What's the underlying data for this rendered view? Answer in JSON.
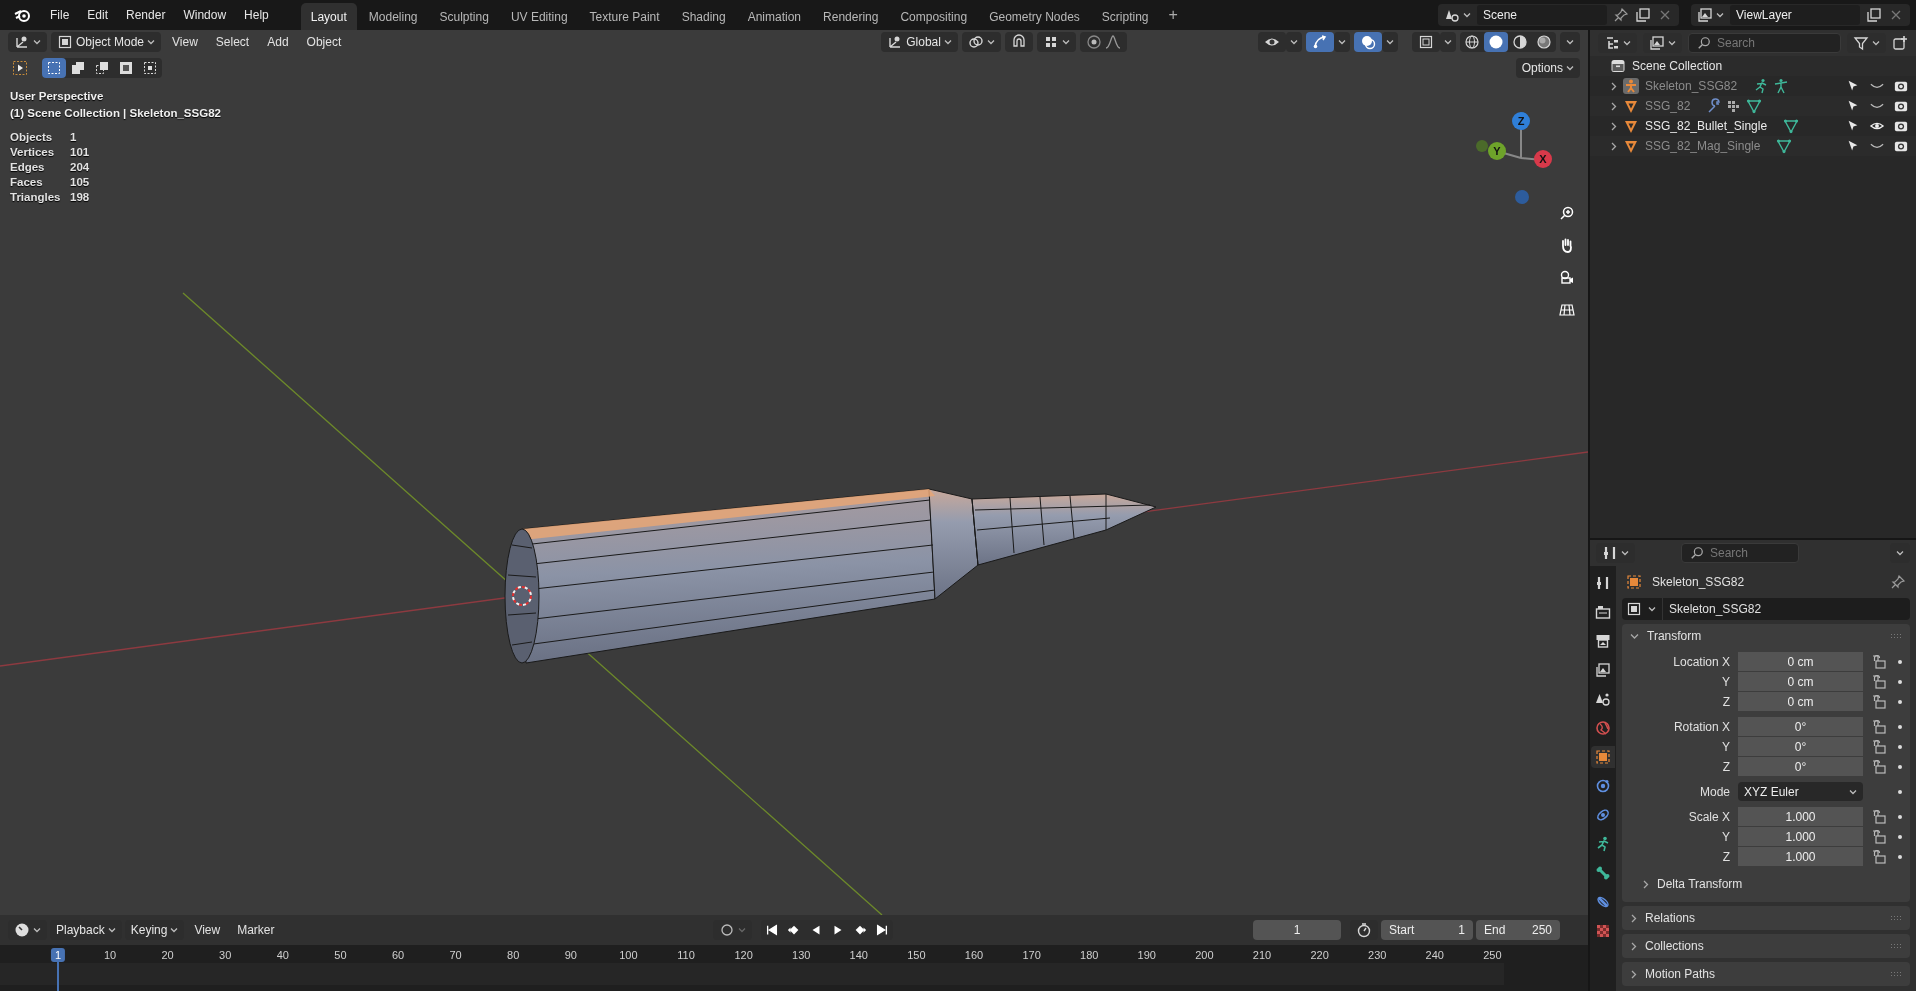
{
  "topbar": {
    "menus": [
      "File",
      "Edit",
      "Render",
      "Window",
      "Help"
    ],
    "workspaces": [
      {
        "label": "Layout",
        "selected": true
      },
      {
        "label": "Modeling",
        "selected": false
      },
      {
        "label": "Sculpting",
        "selected": false
      },
      {
        "label": "UV Editing",
        "selected": false
      },
      {
        "label": "Texture Paint",
        "selected": false
      },
      {
        "label": "Shading",
        "selected": false
      },
      {
        "label": "Animation",
        "selected": false
      },
      {
        "label": "Rendering",
        "selected": false
      },
      {
        "label": "Compositing",
        "selected": false
      },
      {
        "label": "Geometry Nodes",
        "selected": false
      },
      {
        "label": "Scripting",
        "selected": false
      }
    ],
    "add_workspace": "+",
    "scene": "Scene",
    "view_layer": "ViewLayer"
  },
  "viewport": {
    "mode": "Object Mode",
    "menus": [
      "View",
      "Select",
      "Add",
      "Object"
    ],
    "orientation": "Global",
    "toggles": [
      {
        "kind": "visibility",
        "on": false
      },
      {
        "kind": "gizmo",
        "on": true
      },
      {
        "kind": "overlay",
        "on": true
      },
      {
        "kind": "xray",
        "on": false
      }
    ],
    "shading": [
      {
        "kind": "wireframe",
        "selected": false
      },
      {
        "kind": "solid",
        "selected": true
      },
      {
        "kind": "material",
        "selected": false
      },
      {
        "kind": "rendered",
        "selected": false
      }
    ],
    "select_modes": [
      {
        "kind": "set",
        "selected": true
      },
      {
        "kind": "extend",
        "selected": false
      },
      {
        "kind": "subtract",
        "selected": false
      },
      {
        "kind": "invert",
        "selected": false
      },
      {
        "kind": "intersect",
        "selected": false
      }
    ],
    "options": "Options",
    "view_name": "User Perspective",
    "context": "(1) Scene Collection | Skeleton_SSG82",
    "stats": [
      {
        "label": "Objects",
        "value": "1"
      },
      {
        "label": "Vertices",
        "value": "101"
      },
      {
        "label": "Edges",
        "value": "204"
      },
      {
        "label": "Faces",
        "value": "105"
      },
      {
        "label": "Triangles",
        "value": "198"
      }
    ],
    "gizmo_axes": [
      {
        "label": "Z",
        "color": "#2f7fd8"
      },
      {
        "label": "Y",
        "color": "#6ea32a"
      },
      {
        "label": "X",
        "color": "#d8394a"
      }
    ]
  },
  "timeline": {
    "menus": [
      {
        "label": "Playback",
        "dropdown": true
      },
      {
        "label": "Keying",
        "dropdown": true
      },
      {
        "label": "View",
        "dropdown": false
      },
      {
        "label": "Marker",
        "dropdown": false
      }
    ],
    "current_frame": "1",
    "start_label": "Start",
    "start": "1",
    "end_label": "End",
    "end": "250",
    "ruler": [
      {
        "label": "1",
        "selected": true
      },
      {
        "label": "10",
        "selected": false
      },
      {
        "label": "20",
        "selected": false
      },
      {
        "label": "30",
        "selected": false
      },
      {
        "label": "40",
        "selected": false
      },
      {
        "label": "50",
        "selected": false
      },
      {
        "label": "60",
        "selected": false
      },
      {
        "label": "70",
        "selected": false
      },
      {
        "label": "80",
        "selected": false
      },
      {
        "label": "90",
        "selected": false
      },
      {
        "label": "100",
        "selected": false
      },
      {
        "label": "110",
        "selected": false
      },
      {
        "label": "120",
        "selected": false
      },
      {
        "label": "130",
        "selected": false
      },
      {
        "label": "140",
        "selected": false
      },
      {
        "label": "150",
        "selected": false
      },
      {
        "label": "160",
        "selected": false
      },
      {
        "label": "170",
        "selected": false
      },
      {
        "label": "180",
        "selected": false
      },
      {
        "label": "190",
        "selected": false
      },
      {
        "label": "200",
        "selected": false
      },
      {
        "label": "210",
        "selected": false
      },
      {
        "label": "220",
        "selected": false
      },
      {
        "label": "230",
        "selected": false
      },
      {
        "label": "240",
        "selected": false
      },
      {
        "label": "250",
        "selected": false
      }
    ]
  },
  "outliner": {
    "search_placeholder": "Search",
    "root": "Scene Collection",
    "items": [
      {
        "name": "Skeleton_SSG82",
        "kind": "armature",
        "visible": false,
        "badges": [
          {
            "kind": "armature"
          },
          {
            "kind": "pose"
          }
        ]
      },
      {
        "name": "SSG_82",
        "kind": "mesh",
        "visible": false,
        "badges": [
          {
            "kind": "modifier"
          },
          {
            "kind": "vertex-groups"
          },
          {
            "kind": "mesh"
          }
        ]
      },
      {
        "name": "SSG_82_Bullet_Single",
        "kind": "mesh",
        "visible": true,
        "badges": [
          {
            "kind": "mesh"
          }
        ]
      },
      {
        "name": "SSG_82_Mag_Single",
        "kind": "mesh",
        "visible": false,
        "badges": [
          {
            "kind": "mesh"
          }
        ]
      }
    ]
  },
  "properties": {
    "search_placeholder": "Search",
    "tabs": [
      {
        "kind": "tool",
        "selected": false
      },
      {
        "kind": "render",
        "selected": false
      },
      {
        "kind": "output",
        "selected": false
      },
      {
        "kind": "view-layer",
        "selected": false
      },
      {
        "kind": "scene",
        "selected": false
      },
      {
        "kind": "world",
        "selected": false
      },
      {
        "kind": "object",
        "selected": true
      },
      {
        "kind": "physics",
        "selected": false
      },
      {
        "kind": "constraints",
        "selected": false
      },
      {
        "kind": "data",
        "selected": false
      },
      {
        "kind": "bone",
        "selected": false
      },
      {
        "kind": "bone-constraint",
        "selected": false
      },
      {
        "kind": "texture",
        "selected": false
      }
    ],
    "object_name": "Skeleton_SSG82",
    "name_field": "Skeleton_SSG82",
    "panels": [
      {
        "title": "Transform",
        "expanded": true,
        "groups": [
          {
            "rows": [
              {
                "label": "Location X",
                "value": "0 cm",
                "kind": "number"
              },
              {
                "label": "Y",
                "value": "0 cm",
                "kind": "number"
              },
              {
                "label": "Z",
                "value": "0 cm",
                "kind": "number"
              }
            ]
          },
          {
            "rows": [
              {
                "label": "Rotation X",
                "value": "0°",
                "kind": "number"
              },
              {
                "label": "Y",
                "value": "0°",
                "kind": "number"
              },
              {
                "label": "Z",
                "value": "0°",
                "kind": "number"
              }
            ]
          },
          {
            "rows": [
              {
                "label": "Mode",
                "value": "XYZ Euler",
                "kind": "dropdown"
              }
            ]
          },
          {
            "rows": [
              {
                "label": "Scale X",
                "value": "1.000",
                "kind": "number"
              },
              {
                "label": "Y",
                "value": "1.000",
                "kind": "number"
              },
              {
                "label": "Z",
                "value": "1.000",
                "kind": "number"
              }
            ]
          }
        ],
        "subpanels": [
          {
            "title": "Delta Transform",
            "expanded": false
          }
        ]
      },
      {
        "title": "Relations",
        "expanded": false
      },
      {
        "title": "Collections",
        "expanded": false
      },
      {
        "title": "Motion Paths",
        "expanded": false
      }
    ]
  }
}
